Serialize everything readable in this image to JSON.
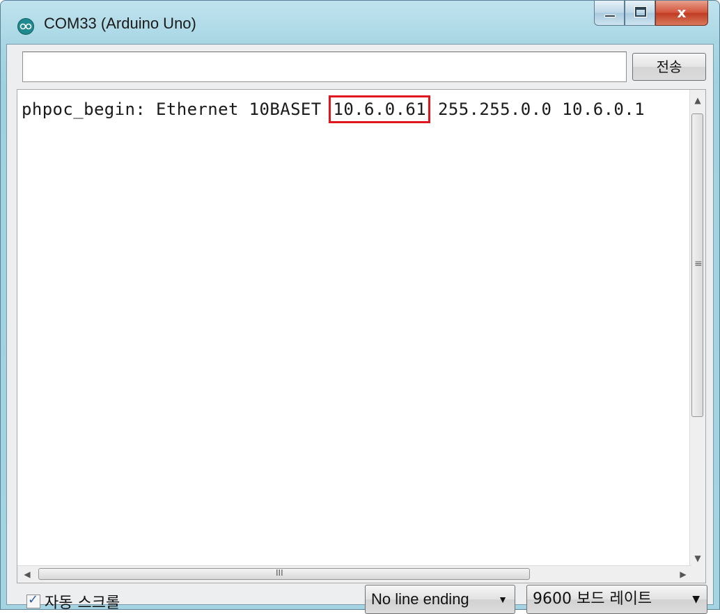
{
  "window": {
    "title": "COM33 (Arduino Uno)",
    "icon": "arduino-icon",
    "close_glyph": "x"
  },
  "send_bar": {
    "input_value": "",
    "send_label": "전송"
  },
  "output": {
    "line_prefix": "phpoc_begin: Ethernet 10BASET ",
    "highlighted_ip": "10.6.0.61",
    "line_suffix": " 255.255.0.0 10.6.0.1",
    "highlight_color": "#e0161e"
  },
  "scrollbars": {
    "vertical_grip": "≡",
    "horizontal_grip": "III"
  },
  "bottom_bar": {
    "autoscroll_label": "자동 스크롤",
    "autoscroll_checked": true,
    "line_ending_value": "No line ending",
    "baud_value": "9600 보드 레이트"
  }
}
